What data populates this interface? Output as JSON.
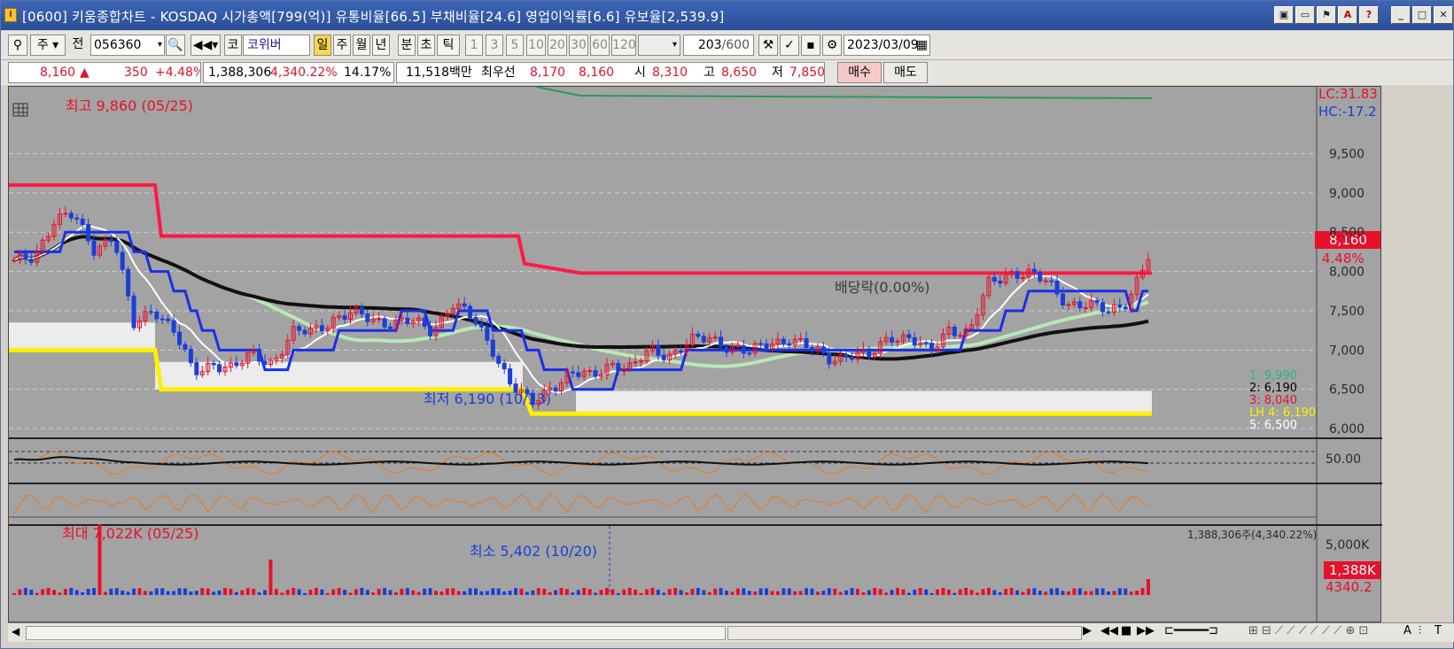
{
  "window": {
    "title": "[0600] 키움종합차트 - KOSDAQ 시가총액[799(억)] 유통비율[66.5] 부채비율[24.6] 영업이익률[6.6] 유보율[2,539.9]",
    "app_icon": "I",
    "buttons": [
      "A",
      "?"
    ]
  },
  "toolbar": {
    "period": "주",
    "prev": "전",
    "code": "056360",
    "name": "코위버",
    "intervals": [
      "일",
      "주",
      "월",
      "년",
      "분",
      "초",
      "틱"
    ],
    "active_interval": "일",
    "minutes": [
      "1",
      "3",
      "5",
      "10",
      "20",
      "30",
      "60",
      "120"
    ],
    "count": "203",
    "count_total": "/600",
    "date": "2023/03/09"
  },
  "quote": {
    "price": "8,160",
    "up_arrow": "▲",
    "change": "350",
    "change_pct": "+4.48%",
    "volume": "1,388,306",
    "volume_ratio": "4,340.22%",
    "turnover": "14.17%",
    "amount": "11,518백만",
    "best_label": "최우선",
    "ask": "8,170",
    "bid": "8,160",
    "open_label": "시",
    "open": "8,310",
    "high_label": "고",
    "high": "8,650",
    "low_label": "저",
    "low": "7,850",
    "buy_label": "매수",
    "sell_label": "매도"
  },
  "chart_data": [
    {
      "type": "candlestick",
      "price_axis_ticks": [
        "9,500",
        "9,000",
        "8,500",
        "8,000",
        "7,500",
        "7,000",
        "6,500",
        "6,000"
      ],
      "ylim": [
        5900,
        10350
      ],
      "highest_annotation": "최고 9,860 (05/25)",
      "lowest_annotation": "최저 6,190 (10/13)",
      "event_annotation": "배당락(0.00%)",
      "current_price_label": "8,160",
      "current_pct_label": "4.48%",
      "lc_label": "LC:31.83",
      "hc_label": "HC:-17.2",
      "legend": [
        "1: 9,990",
        "2: 6,190",
        "3: 8,040",
        "LH 4: 6,190",
        "5: 6,500"
      ],
      "legend_colors": [
        "#2cb37a",
        "#000000",
        "#e8102a",
        "#ffef00",
        "#ffffff"
      ],
      "price_path": [
        8100,
        8200,
        8650,
        8700,
        8300,
        8450,
        7300,
        7550,
        7250,
        6700,
        6850,
        6750,
        6950,
        6850,
        7200,
        7250,
        7400,
        7450,
        7400,
        7350,
        7350,
        7250,
        7600,
        7400,
        7050,
        6550,
        6300,
        6550,
        6700,
        6650,
        6850,
        6750,
        7000,
        6950,
        7100,
        7150,
        7050,
        6950,
        7100,
        7150,
        7000,
        6900,
        6950,
        6900,
        7200,
        7150,
        6950,
        7300,
        7200,
        7850,
        8000,
        7950,
        7850,
        7600,
        7550,
        7500,
        7650,
        8160
      ]
    },
    {
      "type": "line",
      "indicator_tick": "50.00"
    },
    {
      "type": "area",
      "indicator": "histogram"
    },
    {
      "type": "bar",
      "volume_ticks": [
        "5,000K"
      ],
      "max_annotation": "최대 7,022K (05/25)",
      "min_annotation": "최소 5,402 (10/20)",
      "volume_summary": "1,388,306주(4,340.22%)",
      "current_volume_label": "1,388K",
      "current_volume_pct": "4340.2"
    }
  ],
  "colors": {
    "chart_bg": "#a3a3a3",
    "up": "#e8102a",
    "down": "#1a3fd8",
    "ma_white": "#ffffff",
    "ma_black": "#111111",
    "ma_green": "#b9e8b5",
    "band_yellow": "#ffef00"
  }
}
